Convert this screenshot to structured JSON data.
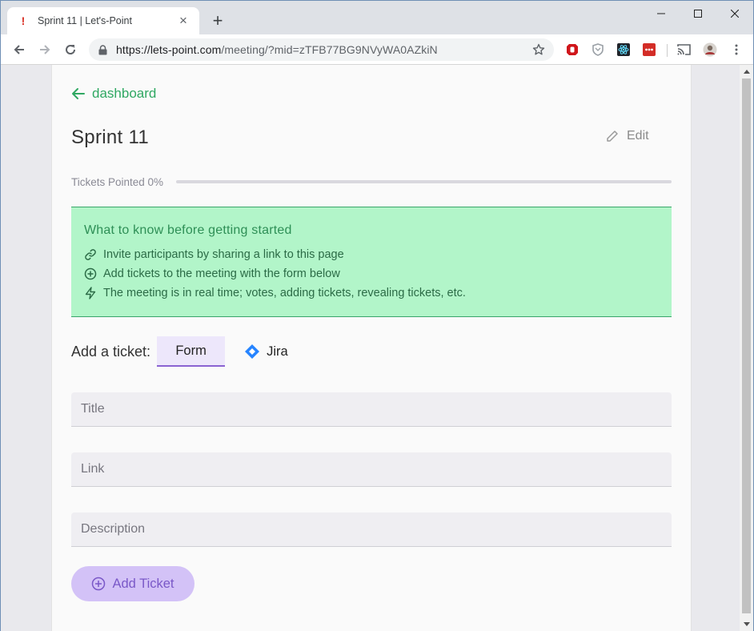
{
  "browser": {
    "tab_title": "Sprint 11 | Let's-Point",
    "favicon": "!",
    "close_glyph": "×",
    "newtab_glyph": "+",
    "url_host": "https://lets-point.com",
    "url_path": "/meeting/?mid=zTFB77BG9NVyWA0AZkiN",
    "extensions": [
      "ublock-icon",
      "shield-extension-icon",
      "react-devtools-icon",
      "lastpass-icon"
    ],
    "icons": [
      "back-arrow-icon",
      "forward-arrow-icon",
      "reload-icon",
      "lock-icon",
      "star-icon",
      "cast-icon",
      "profile-avatar",
      "kebab-menu-icon"
    ]
  },
  "page": {
    "back_link": "dashboard",
    "title": "Sprint 11",
    "edit_label": "Edit",
    "progress": {
      "label": "Tickets Pointed 0%",
      "value": 0
    },
    "info": {
      "title": "What to know before getting started",
      "items": [
        {
          "icon": "link-icon",
          "text": "Invite participants by sharing a link to this page"
        },
        {
          "icon": "plus-circle-icon",
          "text": "Add tickets to the meeting with the form below"
        },
        {
          "icon": "lightning-icon",
          "text": "The meeting is in real time; votes, adding tickets, revealing tickets, etc."
        }
      ]
    },
    "add_ticket": {
      "label": "Add a ticket:",
      "tabs": [
        "Form",
        "Jira"
      ],
      "active_tab": "Form"
    },
    "form": {
      "title_placeholder": "Title",
      "link_placeholder": "Link",
      "description_placeholder": "Description",
      "submit_label": "Add Ticket"
    }
  },
  "colors": {
    "accent_green": "#2fa862",
    "info_bg": "#b2f5c9",
    "accent_purple": "#8a63d2",
    "button_bg": "#d3c2f7"
  }
}
